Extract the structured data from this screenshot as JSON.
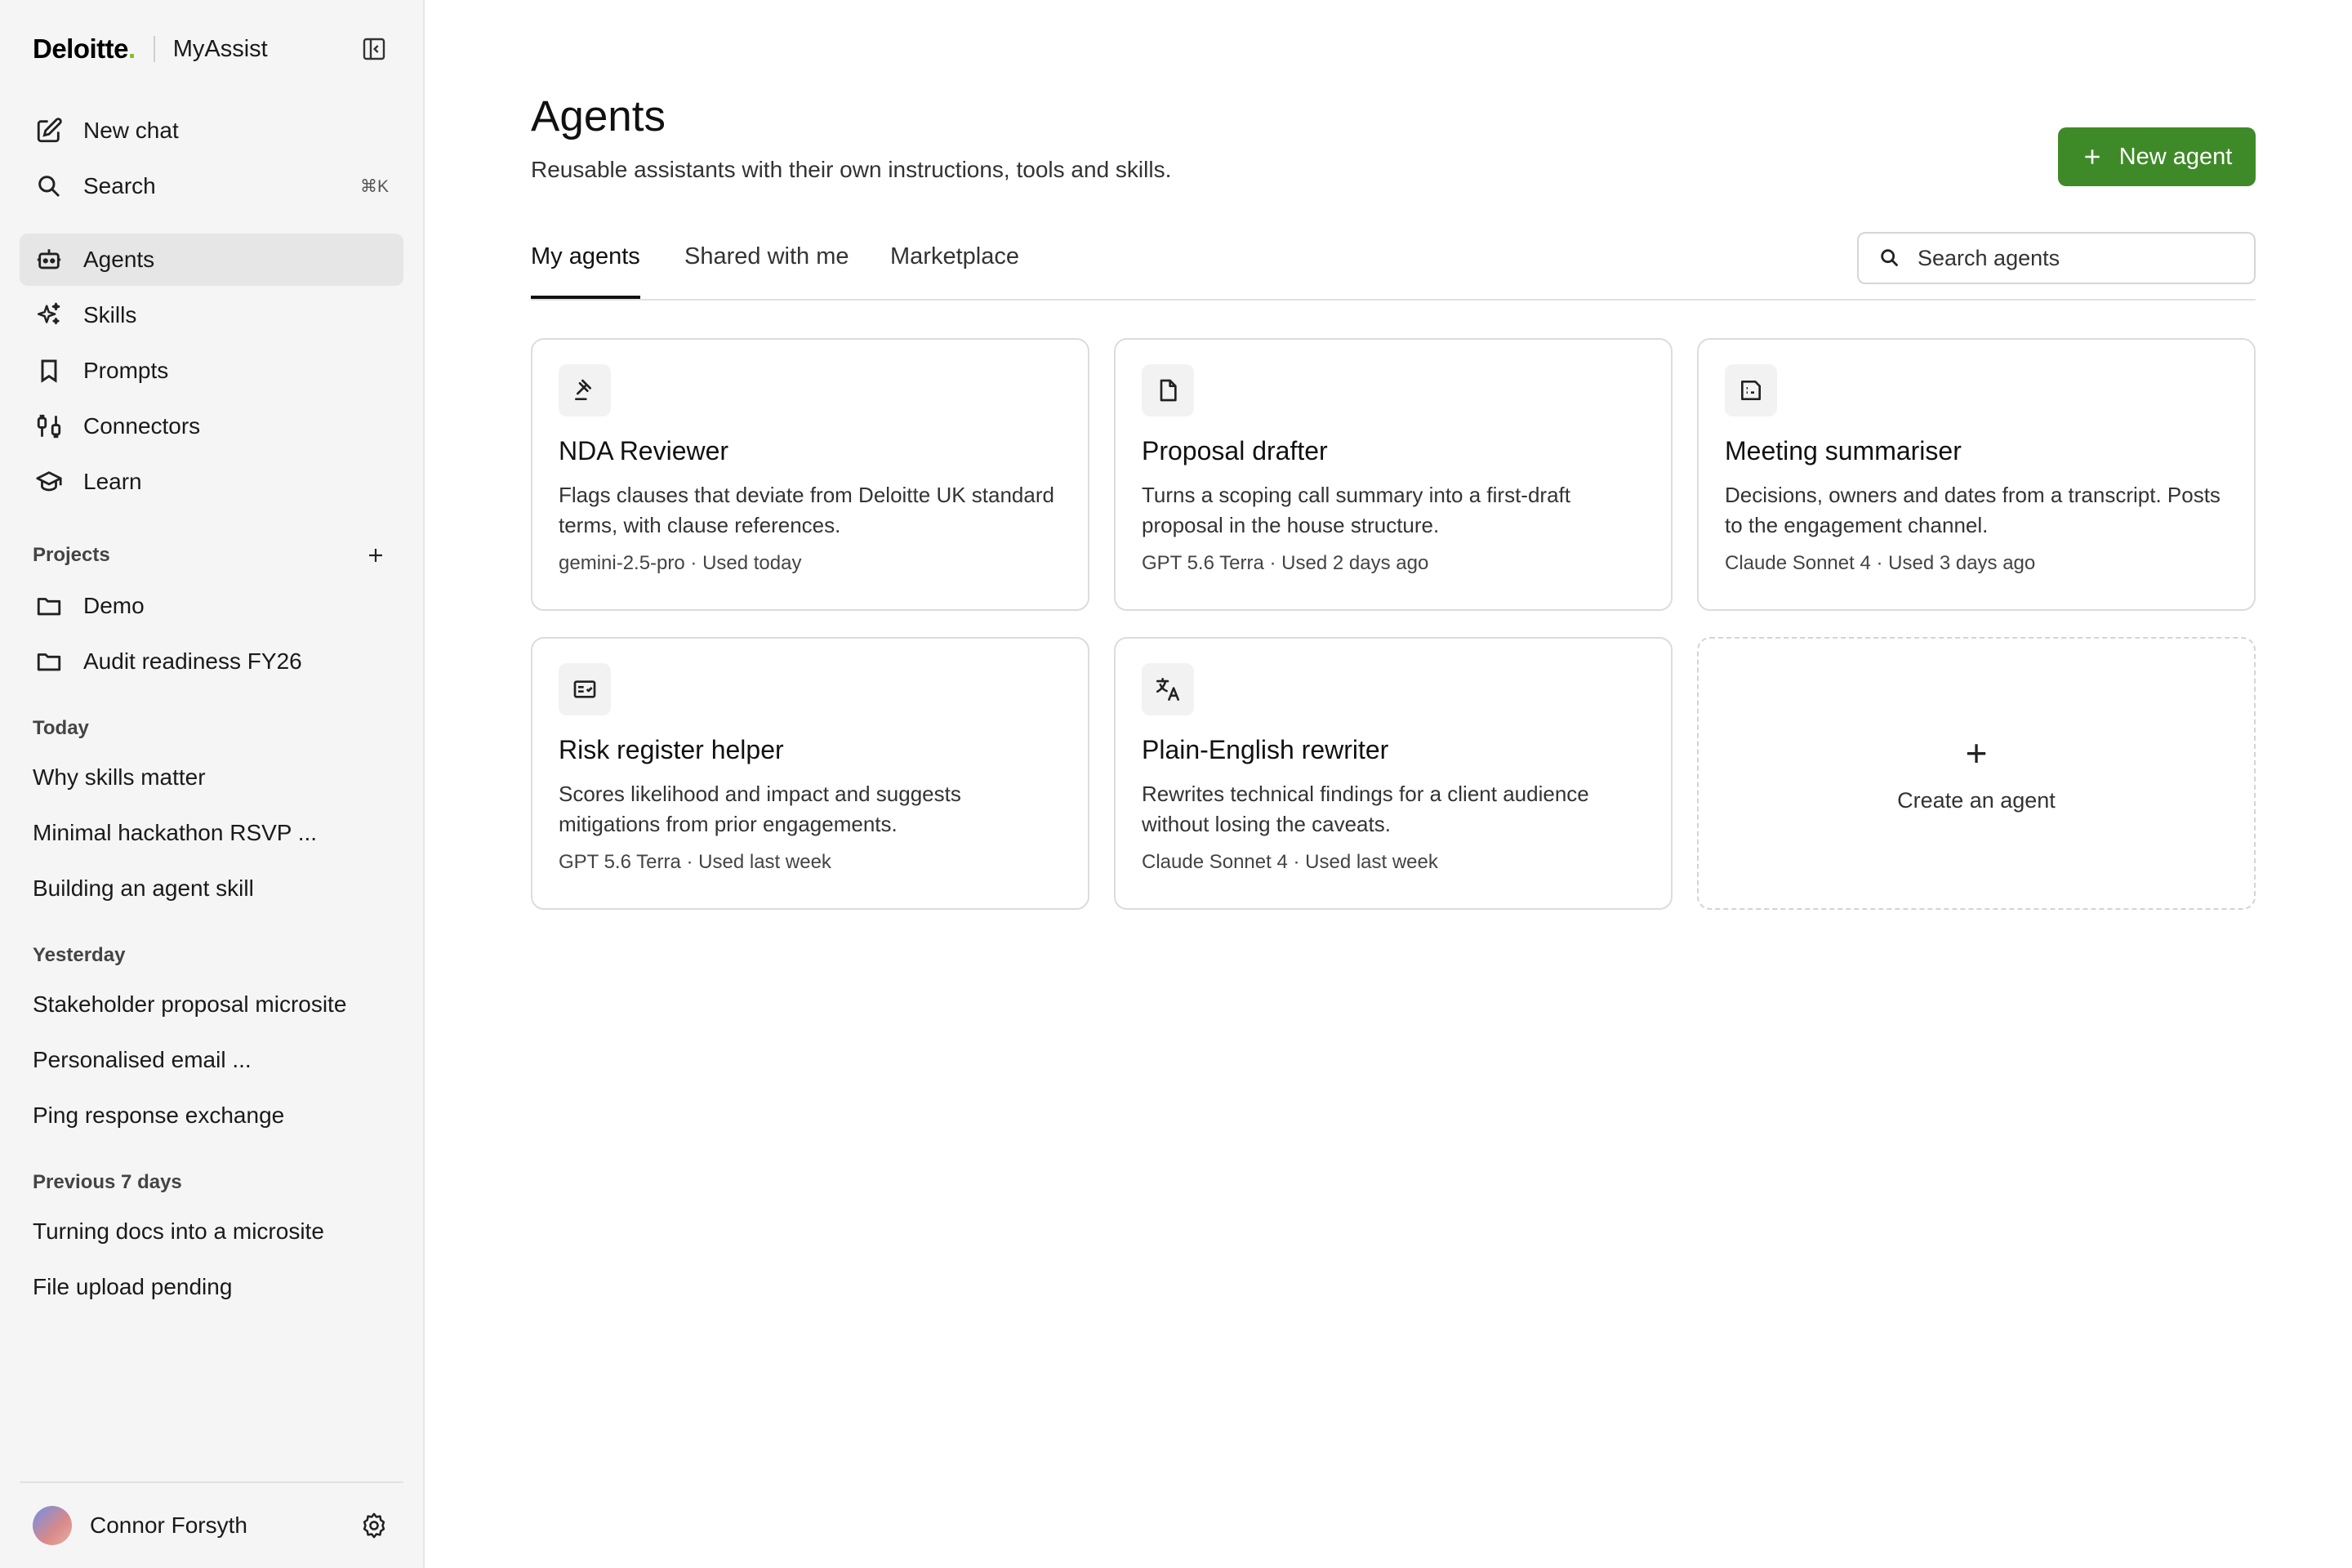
{
  "brand": {
    "logo": "Deloitte",
    "logo_dot": ".",
    "app_name": "MyAssist"
  },
  "sidebar": {
    "new_chat": "New chat",
    "search": "Search",
    "search_shortcut": "⌘K",
    "nav": [
      {
        "label": "Agents",
        "icon": "agent-icon"
      },
      {
        "label": "Skills",
        "icon": "sparkle-icon"
      },
      {
        "label": "Prompts",
        "icon": "bookmark-icon"
      },
      {
        "label": "Connectors",
        "icon": "connector-icon"
      },
      {
        "label": "Learn",
        "icon": "graduation-cap-icon"
      }
    ],
    "projects_label": "Projects",
    "projects": [
      "Demo",
      "Audit readiness FY26"
    ],
    "history": [
      {
        "label": "Today",
        "items": [
          "Why skills matter",
          "Minimal hackathon RSVP ...",
          "Building an agent skill"
        ]
      },
      {
        "label": "Yesterday",
        "items": [
          "Stakeholder proposal microsite",
          "Personalised email ...",
          "Ping response exchange"
        ]
      },
      {
        "label": "Previous 7 days",
        "items": [
          "Turning docs into a microsite",
          "File upload pending"
        ]
      }
    ],
    "user_name": "Connor Forsyth"
  },
  "main": {
    "title": "Agents",
    "subtitle": "Reusable assistants with their own instructions, tools and skills.",
    "new_agent_label": "New agent",
    "tabs": [
      "My agents",
      "Shared with me",
      "Marketplace"
    ],
    "search_placeholder": "Search agents",
    "cards": [
      {
        "icon": "gavel-icon",
        "title": "NDA Reviewer",
        "description": "Flags clauses that deviate from Deloitte UK standard terms, with clause references.",
        "meta": "gemini-2.5-pro · Used today"
      },
      {
        "icon": "document-icon",
        "title": "Proposal drafter",
        "description": "Turns a scoping call summary into a first-draft proposal in the house structure.",
        "meta": "GPT 5.6 Terra · Used 2 days ago"
      },
      {
        "icon": "notes-icon",
        "title": "Meeting summariser",
        "description": "Decisions, owners and dates from a transcript. Posts to the engagement channel.",
        "meta": "Claude Sonnet 4 · Used 3 days ago"
      },
      {
        "icon": "checklist-icon",
        "title": "Risk register helper",
        "description": "Scores likelihood and impact and suggests mitigations from prior engagements.",
        "meta": "GPT 5.6 Terra · Used last week"
      },
      {
        "icon": "translate-icon",
        "title": "Plain-English rewriter",
        "description": "Rewrites technical findings for a client audience without losing the caveats.",
        "meta": "Claude Sonnet 4 · Used last week"
      }
    ],
    "create_label": "Create an agent",
    "create_symbol": "+"
  },
  "colors": {
    "primary": "#3f8a28",
    "brand_dot": "#86bc25",
    "sidebar_bg": "#f5f5f5"
  }
}
